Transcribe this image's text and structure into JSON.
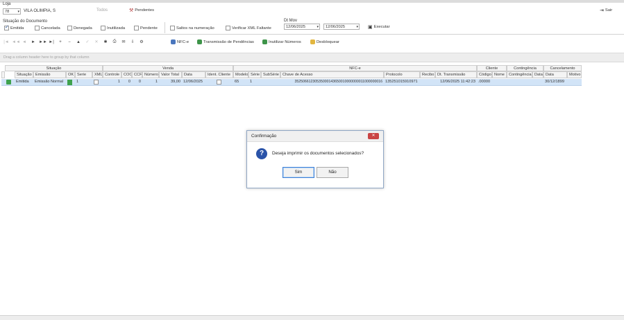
{
  "filters": {
    "loja_label": "Loja",
    "loja_code": "78",
    "loja_name": "VILA OLIMPIA, S",
    "todos_label": "Todos",
    "pendentes_label": "Pendentes",
    "sair_label": "Sair",
    "situacao_title": "Situação do Documento",
    "situacao_options": [
      {
        "label": "Emitida",
        "checked": true
      },
      {
        "label": "Cancelada",
        "checked": false
      },
      {
        "label": "Denegada",
        "checked": false
      },
      {
        "label": "Inutilizada",
        "checked": false
      },
      {
        "label": "Pendente",
        "checked": false
      }
    ],
    "saltos_label": "Saltos na numeração",
    "verificar_label": "Verificar XML Faltante",
    "dt_mov_label": "Dt Mov",
    "date_from": "12/06/2025",
    "date_to": "12/06/2025",
    "executar_label": "Executar"
  },
  "toolbar": {
    "nav_icons": [
      "|◄",
      "◄◄",
      "◄",
      "►",
      "►►",
      "►|",
      "+",
      "−",
      "▲",
      "✓",
      "✕",
      "✱"
    ],
    "buttons": [
      "NFC-e",
      "Transmissão de Pendências",
      "Inutilizar Números",
      "Desbloquear"
    ]
  },
  "grid": {
    "group_hint": "Drag a column header here to group by that column",
    "groups": [
      "Situação",
      "Venda",
      "NFC-e",
      "Cliente",
      "Contingência",
      "Cancelamento"
    ],
    "columns": [
      "Situação",
      "Emissão",
      "OK",
      "Serie",
      "XML",
      "Controle",
      "COO",
      "CCF",
      "Número",
      "Valor Total",
      "Data",
      "Ident. Cliente",
      "Modelo",
      "Série",
      "SubSérie",
      "Chave de Acesso",
      "Protocolo",
      "Recibo",
      "Dt. Transmissão",
      "Código",
      "Nome",
      "Contingência",
      "Data",
      "Data",
      "Motivo"
    ],
    "row": {
      "situacao": "Emitida",
      "emissao": "Emissão Normal",
      "serie": "1",
      "controle": "1",
      "coo": "0",
      "ccf": "0",
      "numero": "1",
      "valor_total": "39,00",
      "data": "12/06/2025",
      "modelo": "65",
      "serie_nfce": "1",
      "chave": "35250661230535000143650010000000011000000016",
      "protocolo": "135251015910971",
      "dt_transmissao": "12/06/2025 11:42:23",
      "codigo": ".00000",
      "canc_data": "30/12/1899"
    }
  },
  "dialog": {
    "title": "Confirmação",
    "close": "✕",
    "icon": "question-icon",
    "message": "Deseja imprimir os documentos selecionados?",
    "yes_label": "Sim",
    "no_label": "Não"
  }
}
